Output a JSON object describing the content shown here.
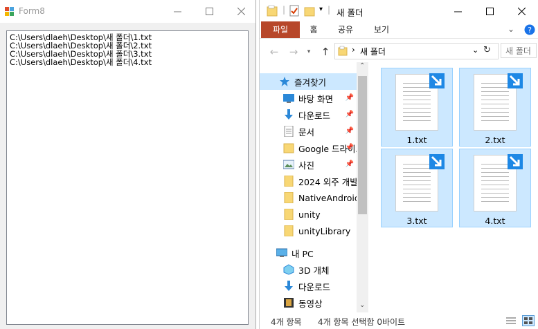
{
  "form8": {
    "title": "Form8",
    "lines": [
      "C:\\Users\\dlaeh\\Desktop\\새 폴더\\1.txt",
      "C:\\Users\\dlaeh\\Desktop\\새 폴더\\2.txt",
      "C:\\Users\\dlaeh\\Desktop\\새 폴더\\3.txt",
      "C:\\Users\\dlaeh\\Desktop\\새 폴더\\4.txt"
    ]
  },
  "explorer": {
    "title": "새 폴더",
    "tabs": [
      "파일",
      "홈",
      "공유",
      "보기"
    ],
    "address": "새 폴더",
    "search_placeholder": "새 폴더",
    "nav": {
      "quick_access": "즐겨찾기",
      "items": [
        {
          "label": "바탕 화면",
          "icon": "desktop-icon",
          "pinned": true
        },
        {
          "label": "다운로드",
          "icon": "download-icon",
          "pinned": true
        },
        {
          "label": "문서",
          "icon": "document-icon",
          "pinned": true
        },
        {
          "label": "Google 드라이브",
          "icon": "folder-icon",
          "pinned": true
        },
        {
          "label": "사진",
          "icon": "pictures-icon",
          "pinned": true
        },
        {
          "label": "2024 외주 개발",
          "icon": "folder-icon",
          "pinned": false
        },
        {
          "label": "NativeAndroidApp",
          "icon": "folder-icon",
          "pinned": false
        },
        {
          "label": "unity",
          "icon": "folder-icon",
          "pinned": false
        },
        {
          "label": "unityLibrary",
          "icon": "folder-icon",
          "pinned": false
        }
      ],
      "this_pc": "내 PC",
      "pc_items": [
        {
          "label": "3D 개체",
          "icon": "3d-objects-icon"
        },
        {
          "label": "다운로드",
          "icon": "download-icon"
        },
        {
          "label": "동영상",
          "icon": "video-icon"
        }
      ]
    },
    "files": [
      "1.txt",
      "2.txt",
      "3.txt",
      "4.txt"
    ],
    "status": {
      "count": "4개 항목",
      "selected": "4개 항목 선택함 0바이트"
    },
    "colors": {
      "file_tab": "#b7472a",
      "selection": "#cce8ff",
      "accent": "#1a73e8"
    }
  }
}
